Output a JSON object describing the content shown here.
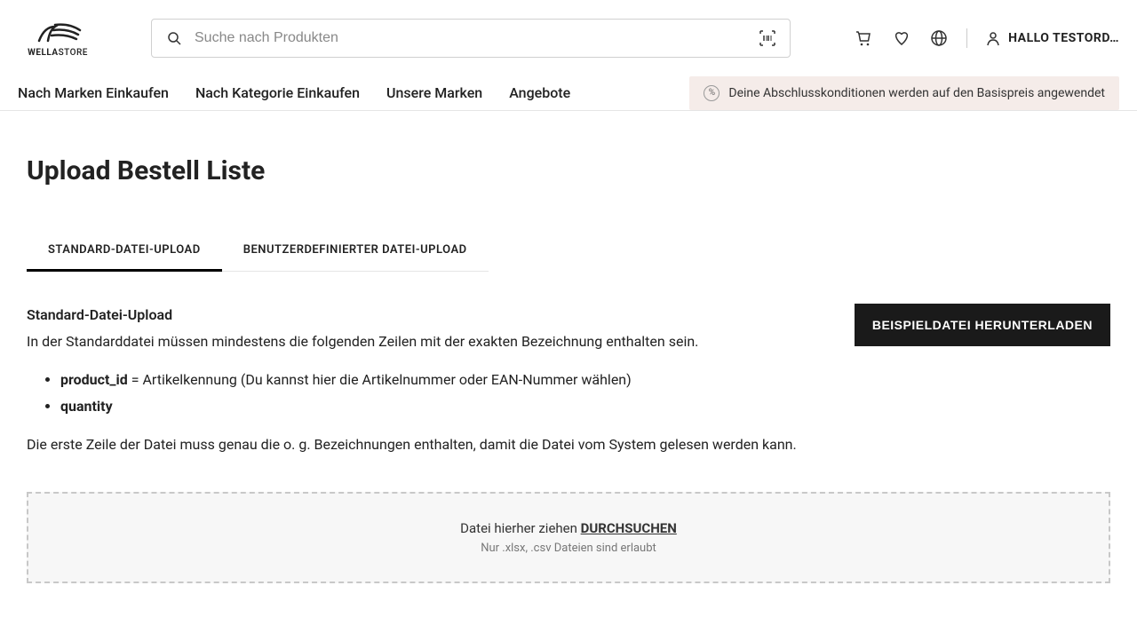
{
  "header": {
    "logo_text_bold": "WELLA",
    "logo_text_light": "STORE",
    "search_placeholder": "Suche nach Produkten",
    "greeting": "HALLO TESTORD…"
  },
  "nav": {
    "items": [
      "Nach Marken Einkaufen",
      "Nach Kategorie Einkaufen",
      "Unsere Marken",
      "Angebote"
    ],
    "notice": "Deine Abschlusskonditionen werden auf den Basispreis angewendet"
  },
  "page": {
    "title": "Upload Bestell Liste",
    "tabs": {
      "standard": "STANDARD-DATEI-UPLOAD",
      "custom": "BENUTZERDEFINIERTER DATEI-UPLOAD"
    },
    "panel": {
      "heading": "Standard-Datei-Upload",
      "intro": "In der Standarddatei müssen mindestens die folgenden Zeilen mit der exakten Bezeichnung enthalten sein.",
      "field1_name": "product_id",
      "field1_desc": " = Artikelkennung (Du kannst hier die Artikelnummer oder EAN-Nummer wählen)",
      "field2_name": "quantity",
      "outro": "Die erste Zeile der Datei muss genau die o. g. Bezeichnungen enthalten, damit die Datei vom System gelesen werden kann.",
      "download_btn": "BEISPIELDATEI HERUNTERLADEN"
    },
    "dropzone": {
      "main_pre": "Datei hierher ziehen ",
      "browse": "DURCHSUCHEN",
      "sub": "Nur .xlsx, .csv Dateien sind erlaubt"
    }
  }
}
